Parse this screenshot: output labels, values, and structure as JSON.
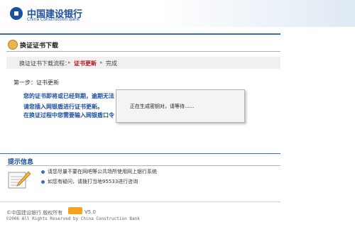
{
  "header": {
    "bank_name_cn": "中国建设银行",
    "bank_name_en": "China Construction Bank",
    "brand_color": "#1c4f9c"
  },
  "page": {
    "title": "换证证书下载"
  },
  "breadcrumb": {
    "items": [
      "换证证书下载流程：",
      "证书更新",
      "完成"
    ],
    "current_color": "#b5121b"
  },
  "step": {
    "label": "第一步：证书更新",
    "notices": [
      "您的证书即将或已经到期，逾期无法",
      "请您插入网银盾进行证书更新。",
      "在换证过程中您需要输入网银盾口令"
    ]
  },
  "modal": {
    "message": "正在生成密钥对，请等待......"
  },
  "tips": {
    "title": "提示信息",
    "items": [
      "请您尽量不要在网吧等公共场所使用网上银行系统",
      "如您有疑问，请拨打当地95533进行咨询"
    ]
  },
  "footer": {
    "copyright_line": "©中国建设银行  版权所有",
    "version": "V5.0",
    "copyright_en": "©2006 All Rights Reserved by China Construction Bank"
  }
}
